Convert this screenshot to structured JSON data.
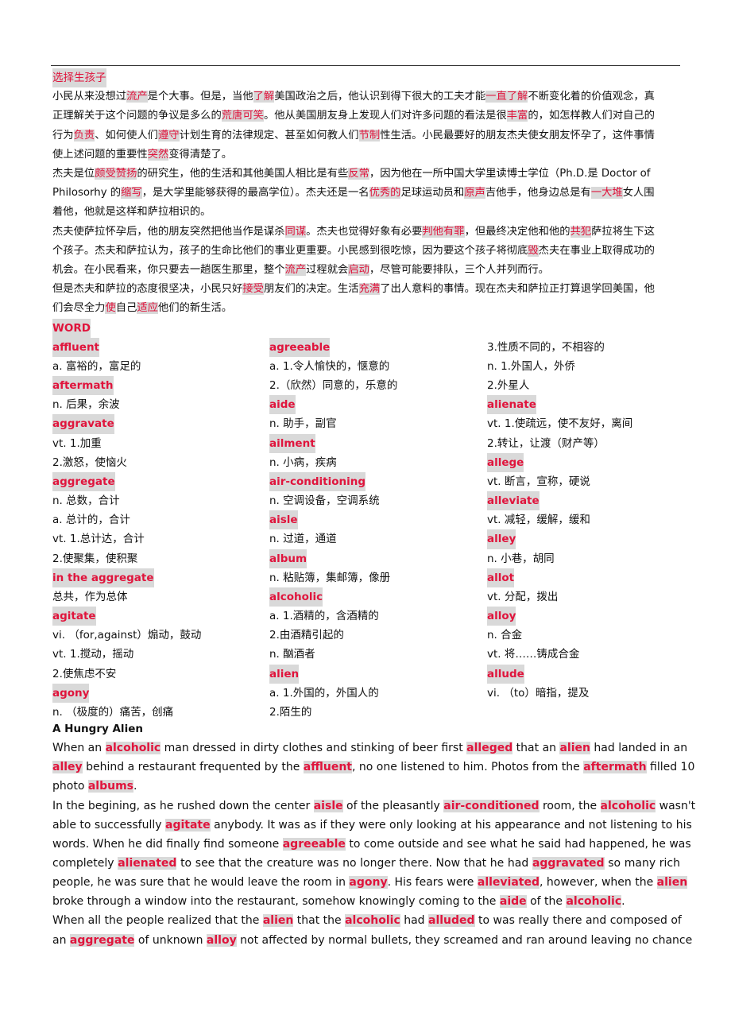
{
  "chinese_section": {
    "title": "选择生孩子",
    "paragraphs": [
      [
        [
          [
            "t",
            "小民从来没想过"
          ],
          [
            "h",
            "流产"
          ],
          [
            "t",
            "是个大事。但是，当他"
          ],
          [
            "h",
            "了解"
          ],
          [
            "t",
            "美国政治之后，他认识到得下很大的工夫才能"
          ],
          [
            "h",
            "一直了解"
          ],
          [
            "t",
            "不断变化着的价值观念，真"
          ]
        ],
        [
          [
            "t",
            "正理解关于这个问题的争议是多么的"
          ],
          [
            "h",
            "荒唐可笑"
          ],
          [
            "t",
            "。他从美国朋友身上发现人们对许多问题的看法是很"
          ],
          [
            "h",
            "丰富"
          ],
          [
            "t",
            "的，如怎样教人们对自己的"
          ]
        ],
        [
          [
            "t",
            "行为"
          ],
          [
            "h",
            "负责"
          ],
          [
            "t",
            "、如何使人们"
          ],
          [
            "h",
            "遵守"
          ],
          [
            "t",
            "计划生育的法律规定、甚至如何教人们"
          ],
          [
            "h",
            "节制"
          ],
          [
            "t",
            "性生活。小民最要好的朋友杰夫使女朋友怀孕了，这件事情"
          ]
        ],
        [
          [
            "t",
            "使上述问题的重要性"
          ],
          [
            "h",
            "突然"
          ],
          [
            "t",
            "变得清楚了。"
          ]
        ]
      ],
      [
        [
          [
            "t",
            "杰夫是位"
          ],
          [
            "h",
            "颇受赞扬"
          ],
          [
            "t",
            "的研究生，他的生活和其他美国人相比是有些"
          ],
          [
            "h",
            "反常"
          ],
          [
            "t",
            "，因为他在一所中国大学里读博士学位（Ph.D.是 Doctor of"
          ]
        ],
        [
          [
            "t",
            "Philosorhy 的"
          ],
          [
            "h",
            "缩写"
          ],
          [
            "t",
            "，是大学里能够获得的最高学位）。杰夫还是一名"
          ],
          [
            "h",
            "优秀的"
          ],
          [
            "t",
            "足球运动员和"
          ],
          [
            "h",
            "原声"
          ],
          [
            "t",
            "吉他手，他身边总是有"
          ],
          [
            "h",
            "一大堆"
          ],
          [
            "t",
            "女人围"
          ]
        ],
        [
          [
            "t",
            "着他，他就是这样和萨拉相识的。"
          ]
        ]
      ],
      [
        [
          [
            "t",
            "杰夫使萨拉怀孕后，他的朋友突然把他当作是谋杀"
          ],
          [
            "h",
            "同谋"
          ],
          [
            "t",
            "。杰夫也觉得好象有必要"
          ],
          [
            "h",
            "判他有罪"
          ],
          [
            "t",
            "，但最终决定他和他的"
          ],
          [
            "h",
            "共犯"
          ],
          [
            "t",
            "萨拉将生下这"
          ]
        ],
        [
          [
            "t",
            "个孩子。杰夫和萨拉认为，孩子的生命比他们的事业更重要。小民感到很吃惊，因为要这个孩子将彻底"
          ],
          [
            "h",
            "毁"
          ],
          [
            "t",
            "杰夫在事业上取得成功的"
          ]
        ],
        [
          [
            "t",
            "机会。在小民看来，你只要去一趟医生那里，整个"
          ],
          [
            "h",
            "流产"
          ],
          [
            "t",
            "过程就会"
          ],
          [
            "h",
            "启动"
          ],
          [
            "t",
            "，尽管可能要排队，三个人并列而行。"
          ]
        ]
      ],
      [
        [
          [
            "t",
            "但是杰夫和萨拉的态度很坚决，小民只好"
          ],
          [
            "h",
            "接受"
          ],
          [
            "t",
            "朋友们的决定。生活"
          ],
          [
            "h",
            "充满"
          ],
          [
            "t",
            "了出人意料的事情。现在杰夫和萨拉正打算退学回美国，他"
          ]
        ],
        [
          [
            "t",
            "们会尽全力"
          ],
          [
            "h",
            "使"
          ],
          [
            "t",
            "自己"
          ],
          [
            "h",
            "适应"
          ],
          [
            "t",
            "他们的新生活。"
          ]
        ]
      ]
    ]
  },
  "word_section": {
    "heading": "WORD",
    "columns": [
      [
        {
          "type": "word",
          "text": "affluent"
        },
        {
          "type": "def",
          "text": "a. 富裕的，富足的"
        },
        {
          "type": "word",
          "text": "aftermath"
        },
        {
          "type": "def",
          "text": "n. 后果，余波"
        },
        {
          "type": "word",
          "text": "aggravate"
        },
        {
          "type": "def",
          "text": "vt. 1.加重"
        },
        {
          "type": "def",
          "text": "2.激怒，使恼火"
        },
        {
          "type": "word",
          "text": "aggregate"
        },
        {
          "type": "def",
          "text": "n. 总数，合计"
        },
        {
          "type": "def",
          "text": "a. 总计的，合计"
        },
        {
          "type": "def",
          "text": "vt. 1.总计达，合计"
        },
        {
          "type": "def",
          "text": "2.使聚集，使积聚"
        },
        {
          "type": "word",
          "text": "in the aggregate"
        },
        {
          "type": "def",
          "text": "总共，作为总体"
        },
        {
          "type": "word",
          "text": "agitate"
        },
        {
          "type": "def",
          "text": "vi. （for,against）煽动，鼓动"
        },
        {
          "type": "def",
          "text": "vt. 1.搅动，摇动"
        },
        {
          "type": "def",
          "text": "2.使焦虑不安"
        },
        {
          "type": "word",
          "text": "agony"
        },
        {
          "type": "def",
          "text": "n. （极度的）痛苦，创痛"
        }
      ],
      [
        {
          "type": "word",
          "text": "agreeable"
        },
        {
          "type": "def",
          "text": "a. 1.令人愉快的，惬意的"
        },
        {
          "type": "def",
          "text": "2.（欣然）同意的，乐意的"
        },
        {
          "type": "word",
          "text": "aide"
        },
        {
          "type": "def",
          "text": "n. 助手，副官"
        },
        {
          "type": "word",
          "text": "ailment"
        },
        {
          "type": "def",
          "text": "n. 小病，疾病"
        },
        {
          "type": "word",
          "text": "air-conditioning"
        },
        {
          "type": "def",
          "text": "n. 空调设备，空调系统"
        },
        {
          "type": "word",
          "text": "aisle"
        },
        {
          "type": "def",
          "text": "n. 过道，通道"
        },
        {
          "type": "word",
          "text": "album"
        },
        {
          "type": "def",
          "text": "n. 粘贴簿，集邮簿，像册"
        },
        {
          "type": "word",
          "text": "alcoholic"
        },
        {
          "type": "def",
          "text": "a. 1.酒精的，含酒精的"
        },
        {
          "type": "def",
          "text": "2.由酒精引起的"
        },
        {
          "type": "def",
          "text": "n. 酗酒者"
        },
        {
          "type": "word",
          "text": "alien"
        },
        {
          "type": "def",
          "text": "a. 1.外国的，外国人的"
        },
        {
          "type": "def",
          "text": "2.陌生的"
        }
      ],
      [
        {
          "type": "def",
          "text": "3.性质不同的，不相容的"
        },
        {
          "type": "def",
          "text": "n. 1.外国人，外侨"
        },
        {
          "type": "def",
          "text": "2.外星人"
        },
        {
          "type": "word",
          "text": "alienate"
        },
        {
          "type": "def",
          "text": "vt. 1.使疏远，使不友好，离间"
        },
        {
          "type": "def",
          "text": "2.转让，让渡（财产等）"
        },
        {
          "type": "word",
          "text": "allege"
        },
        {
          "type": "def",
          "text": "vt. 断言，宣称，硬说"
        },
        {
          "type": "word",
          "text": "alleviate"
        },
        {
          "type": "def",
          "text": "vt. 减轻，缓解，缓和"
        },
        {
          "type": "word",
          "text": "alley"
        },
        {
          "type": "def",
          "text": "n. 小巷，胡同"
        },
        {
          "type": "word",
          "text": "allot"
        },
        {
          "type": "def",
          "text": "vt. 分配，拨出"
        },
        {
          "type": "word",
          "text": "alloy"
        },
        {
          "type": "def",
          "text": "n. 合金"
        },
        {
          "type": "def",
          "text": "vt. 将……铸成合金"
        },
        {
          "type": "word",
          "text": "allude"
        },
        {
          "type": "def",
          "text": "vi. （to）暗指，提及"
        }
      ]
    ]
  },
  "story_section": {
    "title": "A Hungry Alien",
    "paragraphs": [
      [
        [
          [
            "t",
            "When an "
          ],
          [
            "h",
            "alcoholic"
          ],
          [
            "t",
            " man dressed in dirty clothes and stinking of beer first "
          ],
          [
            "h",
            "alleged"
          ],
          [
            "t",
            " that an "
          ],
          [
            "h",
            "alien"
          ],
          [
            "t",
            " had landed in an"
          ]
        ],
        [
          [
            "h",
            "alley"
          ],
          [
            "t",
            " behind a restaurant frequented by the "
          ],
          [
            "h",
            "affluent"
          ],
          [
            "t",
            ", no one listened to him. Photos from the "
          ],
          [
            "h",
            "aftermath"
          ],
          [
            "t",
            " filled 10"
          ]
        ],
        [
          [
            "t",
            "photo "
          ],
          [
            "h",
            "albums"
          ],
          [
            "t",
            "."
          ]
        ]
      ],
      [
        [
          [
            "t",
            "In the begining, as he rushed down the center "
          ],
          [
            "h",
            "aisle"
          ],
          [
            "t",
            " of the pleasantly "
          ],
          [
            "h",
            "air-conditioned"
          ],
          [
            "t",
            " room, the "
          ],
          [
            "h",
            "alcoholic"
          ],
          [
            "t",
            " wasn't"
          ]
        ],
        [
          [
            "t",
            "able to successfully "
          ],
          [
            "h",
            "agitate"
          ],
          [
            "t",
            " anybody. It was as if they were only looking at his appearance and not listening to his"
          ]
        ],
        [
          [
            "t",
            "words. When he did finally find someone "
          ],
          [
            "h",
            "agreeable"
          ],
          [
            "t",
            " to come outside and see what he said had happened, he was"
          ]
        ],
        [
          [
            "t",
            "completely "
          ],
          [
            "h",
            "alienated"
          ],
          [
            "t",
            " to see that the creature was no longer there. Now that he had "
          ],
          [
            "h",
            "aggravated"
          ],
          [
            "t",
            " so many rich"
          ]
        ],
        [
          [
            "t",
            "people, he was sure that he would leave the room in "
          ],
          [
            "h",
            "agony"
          ],
          [
            "t",
            ". His fears were "
          ],
          [
            "h",
            "alleviated"
          ],
          [
            "t",
            ", however, when the "
          ],
          [
            "h",
            "alien"
          ]
        ],
        [
          [
            "t",
            "broke through a window into the restaurant, somehow knowingly coming to the "
          ],
          [
            "h",
            "aide"
          ],
          [
            "t",
            " of the "
          ],
          [
            "h",
            "alcoholic"
          ],
          [
            "t",
            "."
          ]
        ]
      ],
      [
        [
          [
            "t",
            "When all the people realized that the "
          ],
          [
            "h",
            "alien"
          ],
          [
            "t",
            " that the "
          ],
          [
            "h",
            "alcoholic"
          ],
          [
            "t",
            " had "
          ],
          [
            "h",
            "alluded"
          ],
          [
            "t",
            " to was really there and composed of"
          ]
        ],
        [
          [
            "t",
            "an "
          ],
          [
            "h",
            "aggregate"
          ],
          [
            "t",
            " of unknown "
          ],
          [
            "h",
            "alloy"
          ],
          [
            "t",
            " not affected by normal bullets, they screamed and ran around leaving no chance"
          ]
        ]
      ]
    ]
  },
  "colors": {
    "highlight_text": "#e0143c",
    "highlight_bg": "#d9d9d9",
    "body_text": "#111111",
    "rule": "#333333"
  }
}
